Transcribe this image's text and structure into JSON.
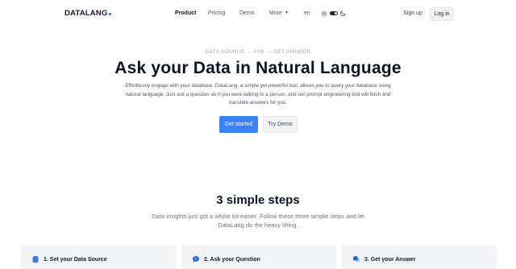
{
  "brand": {
    "name": "DATALANG"
  },
  "nav": {
    "links": [
      {
        "label": "Product",
        "active": true
      },
      {
        "label": "Pricing",
        "active": false
      },
      {
        "label": "Demo",
        "active": false
      },
      {
        "label": "More",
        "active": false,
        "has_dropdown": true
      }
    ],
    "language": "en",
    "theme_icons": [
      "sun-icon",
      "toggle",
      "moon-icon"
    ],
    "sign_up": "Sign up",
    "log_in": "Log in"
  },
  "hero": {
    "eyebrow": "DATA SOURCE → ASK → GET ANSWER",
    "title": "Ask your Data in Natural Language",
    "subtitle": "Effortlessly engage with your database. DataLang, a simple yet powerful tool, allows you to query your database using natural language. Just ask a question as if you were talking to a person, and our prompt engineering tool will fetch and translate answers for you.",
    "primary_cta": "Get started",
    "secondary_cta": "Try Demo"
  },
  "steps": {
    "title": "3 simple steps",
    "subtitle": "Data insights just got a whole lot easier. Follow these three simple steps and let DataLang do the heavy lifting.",
    "cards": [
      {
        "label": "1. Set your Data Source",
        "icon": "database-icon"
      },
      {
        "label": "2. Ask your Question",
        "icon": "chat-bubble-icon"
      },
      {
        "label": "3. Get your Answer",
        "icon": "chat-bubbles-icon"
      }
    ]
  },
  "colors": {
    "accent": "#3b82f6",
    "text_dark": "#0b1324",
    "muted": "#6b7280",
    "card_bg": "#f3f4f6"
  }
}
